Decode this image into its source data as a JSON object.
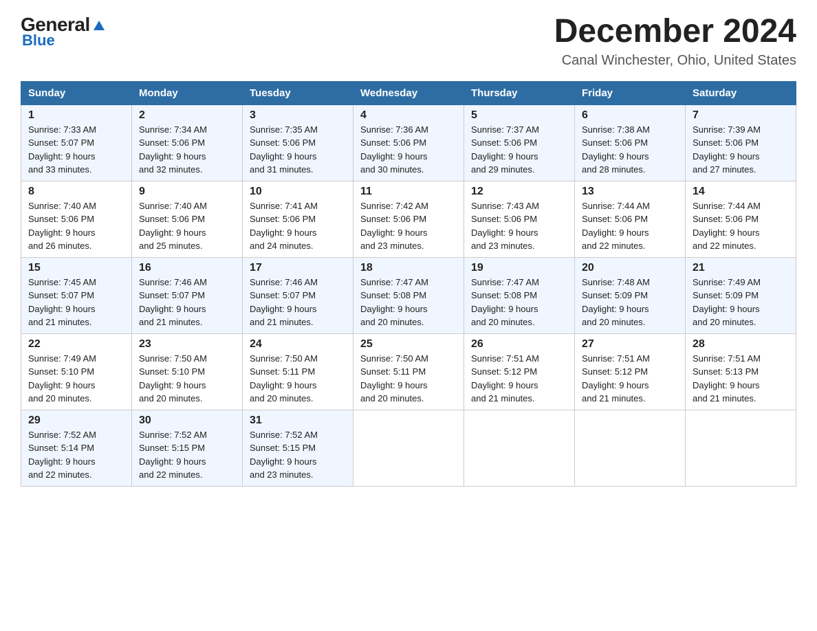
{
  "logo": {
    "general": "General",
    "blue": "Blue"
  },
  "title": "December 2024",
  "subtitle": "Canal Winchester, Ohio, United States",
  "headers": [
    "Sunday",
    "Monday",
    "Tuesday",
    "Wednesday",
    "Thursday",
    "Friday",
    "Saturday"
  ],
  "weeks": [
    [
      {
        "day": "1",
        "sunrise": "7:33 AM",
        "sunset": "5:07 PM",
        "daylight": "9 hours and 33 minutes."
      },
      {
        "day": "2",
        "sunrise": "7:34 AM",
        "sunset": "5:06 PM",
        "daylight": "9 hours and 32 minutes."
      },
      {
        "day": "3",
        "sunrise": "7:35 AM",
        "sunset": "5:06 PM",
        "daylight": "9 hours and 31 minutes."
      },
      {
        "day": "4",
        "sunrise": "7:36 AM",
        "sunset": "5:06 PM",
        "daylight": "9 hours and 30 minutes."
      },
      {
        "day": "5",
        "sunrise": "7:37 AM",
        "sunset": "5:06 PM",
        "daylight": "9 hours and 29 minutes."
      },
      {
        "day": "6",
        "sunrise": "7:38 AM",
        "sunset": "5:06 PM",
        "daylight": "9 hours and 28 minutes."
      },
      {
        "day": "7",
        "sunrise": "7:39 AM",
        "sunset": "5:06 PM",
        "daylight": "9 hours and 27 minutes."
      }
    ],
    [
      {
        "day": "8",
        "sunrise": "7:40 AM",
        "sunset": "5:06 PM",
        "daylight": "9 hours and 26 minutes."
      },
      {
        "day": "9",
        "sunrise": "7:40 AM",
        "sunset": "5:06 PM",
        "daylight": "9 hours and 25 minutes."
      },
      {
        "day": "10",
        "sunrise": "7:41 AM",
        "sunset": "5:06 PM",
        "daylight": "9 hours and 24 minutes."
      },
      {
        "day": "11",
        "sunrise": "7:42 AM",
        "sunset": "5:06 PM",
        "daylight": "9 hours and 23 minutes."
      },
      {
        "day": "12",
        "sunrise": "7:43 AM",
        "sunset": "5:06 PM",
        "daylight": "9 hours and 23 minutes."
      },
      {
        "day": "13",
        "sunrise": "7:44 AM",
        "sunset": "5:06 PM",
        "daylight": "9 hours and 22 minutes."
      },
      {
        "day": "14",
        "sunrise": "7:44 AM",
        "sunset": "5:06 PM",
        "daylight": "9 hours and 22 minutes."
      }
    ],
    [
      {
        "day": "15",
        "sunrise": "7:45 AM",
        "sunset": "5:07 PM",
        "daylight": "9 hours and 21 minutes."
      },
      {
        "day": "16",
        "sunrise": "7:46 AM",
        "sunset": "5:07 PM",
        "daylight": "9 hours and 21 minutes."
      },
      {
        "day": "17",
        "sunrise": "7:46 AM",
        "sunset": "5:07 PM",
        "daylight": "9 hours and 21 minutes."
      },
      {
        "day": "18",
        "sunrise": "7:47 AM",
        "sunset": "5:08 PM",
        "daylight": "9 hours and 20 minutes."
      },
      {
        "day": "19",
        "sunrise": "7:47 AM",
        "sunset": "5:08 PM",
        "daylight": "9 hours and 20 minutes."
      },
      {
        "day": "20",
        "sunrise": "7:48 AM",
        "sunset": "5:09 PM",
        "daylight": "9 hours and 20 minutes."
      },
      {
        "day": "21",
        "sunrise": "7:49 AM",
        "sunset": "5:09 PM",
        "daylight": "9 hours and 20 minutes."
      }
    ],
    [
      {
        "day": "22",
        "sunrise": "7:49 AM",
        "sunset": "5:10 PM",
        "daylight": "9 hours and 20 minutes."
      },
      {
        "day": "23",
        "sunrise": "7:50 AM",
        "sunset": "5:10 PM",
        "daylight": "9 hours and 20 minutes."
      },
      {
        "day": "24",
        "sunrise": "7:50 AM",
        "sunset": "5:11 PM",
        "daylight": "9 hours and 20 minutes."
      },
      {
        "day": "25",
        "sunrise": "7:50 AM",
        "sunset": "5:11 PM",
        "daylight": "9 hours and 20 minutes."
      },
      {
        "day": "26",
        "sunrise": "7:51 AM",
        "sunset": "5:12 PM",
        "daylight": "9 hours and 21 minutes."
      },
      {
        "day": "27",
        "sunrise": "7:51 AM",
        "sunset": "5:12 PM",
        "daylight": "9 hours and 21 minutes."
      },
      {
        "day": "28",
        "sunrise": "7:51 AM",
        "sunset": "5:13 PM",
        "daylight": "9 hours and 21 minutes."
      }
    ],
    [
      {
        "day": "29",
        "sunrise": "7:52 AM",
        "sunset": "5:14 PM",
        "daylight": "9 hours and 22 minutes."
      },
      {
        "day": "30",
        "sunrise": "7:52 AM",
        "sunset": "5:15 PM",
        "daylight": "9 hours and 22 minutes."
      },
      {
        "day": "31",
        "sunrise": "7:52 AM",
        "sunset": "5:15 PM",
        "daylight": "9 hours and 23 minutes."
      },
      null,
      null,
      null,
      null
    ]
  ],
  "labels": {
    "sunrise": "Sunrise:",
    "sunset": "Sunset:",
    "daylight": "Daylight:"
  }
}
